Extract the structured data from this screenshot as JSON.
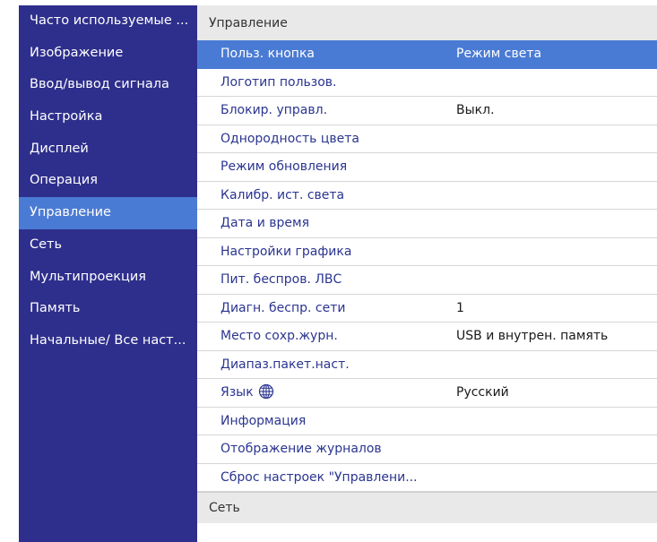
{
  "sidebar": {
    "items": [
      {
        "label": "Часто используемые ..."
      },
      {
        "label": "Изображение"
      },
      {
        "label": "Ввод/вывод сигнала"
      },
      {
        "label": "Настройка"
      },
      {
        "label": "Дисплей"
      },
      {
        "label": "Операция"
      },
      {
        "label": "Управление",
        "active": true
      },
      {
        "label": "Сеть"
      },
      {
        "label": "Мультипроекция"
      },
      {
        "label": "Память"
      },
      {
        "label": "Начальные/ Все наст..."
      }
    ]
  },
  "main": {
    "section_title": "Управление",
    "next_section_title": "Сеть",
    "rows": [
      {
        "label": "Польз. кнопка",
        "value": "Режим света",
        "selected": true
      },
      {
        "label": "Логотип пользов.",
        "value": ""
      },
      {
        "label": "Блокир. управл.",
        "value": "Выкл."
      },
      {
        "label": "Однородность цвета",
        "value": ""
      },
      {
        "label": "Режим обновления",
        "value": ""
      },
      {
        "label": "Калибр. ист. света",
        "value": ""
      },
      {
        "label": "Дата и время",
        "value": ""
      },
      {
        "label": "Настройки графика",
        "value": ""
      },
      {
        "label": "Пит. беспров. ЛВС",
        "value": ""
      },
      {
        "label": "Диагн. беспр. сети",
        "value": "1"
      },
      {
        "label": "Место сохр.журн.",
        "value": "USB и внутрен. память"
      },
      {
        "label": "Диапаз.пакет.наст.",
        "value": ""
      },
      {
        "label": "Язык",
        "value": "Русский",
        "icon": "globe-icon"
      },
      {
        "label": "Информация",
        "value": ""
      },
      {
        "label": "Отображение журналов",
        "value": ""
      },
      {
        "label": "Сброс настроек \"Управлени...",
        "value": ""
      }
    ]
  },
  "colors": {
    "sidebar_bg": "#2e2f8c",
    "highlight": "#4a7bd4",
    "label_text": "#2b3590",
    "panel_bg": "#e9e9e9"
  }
}
